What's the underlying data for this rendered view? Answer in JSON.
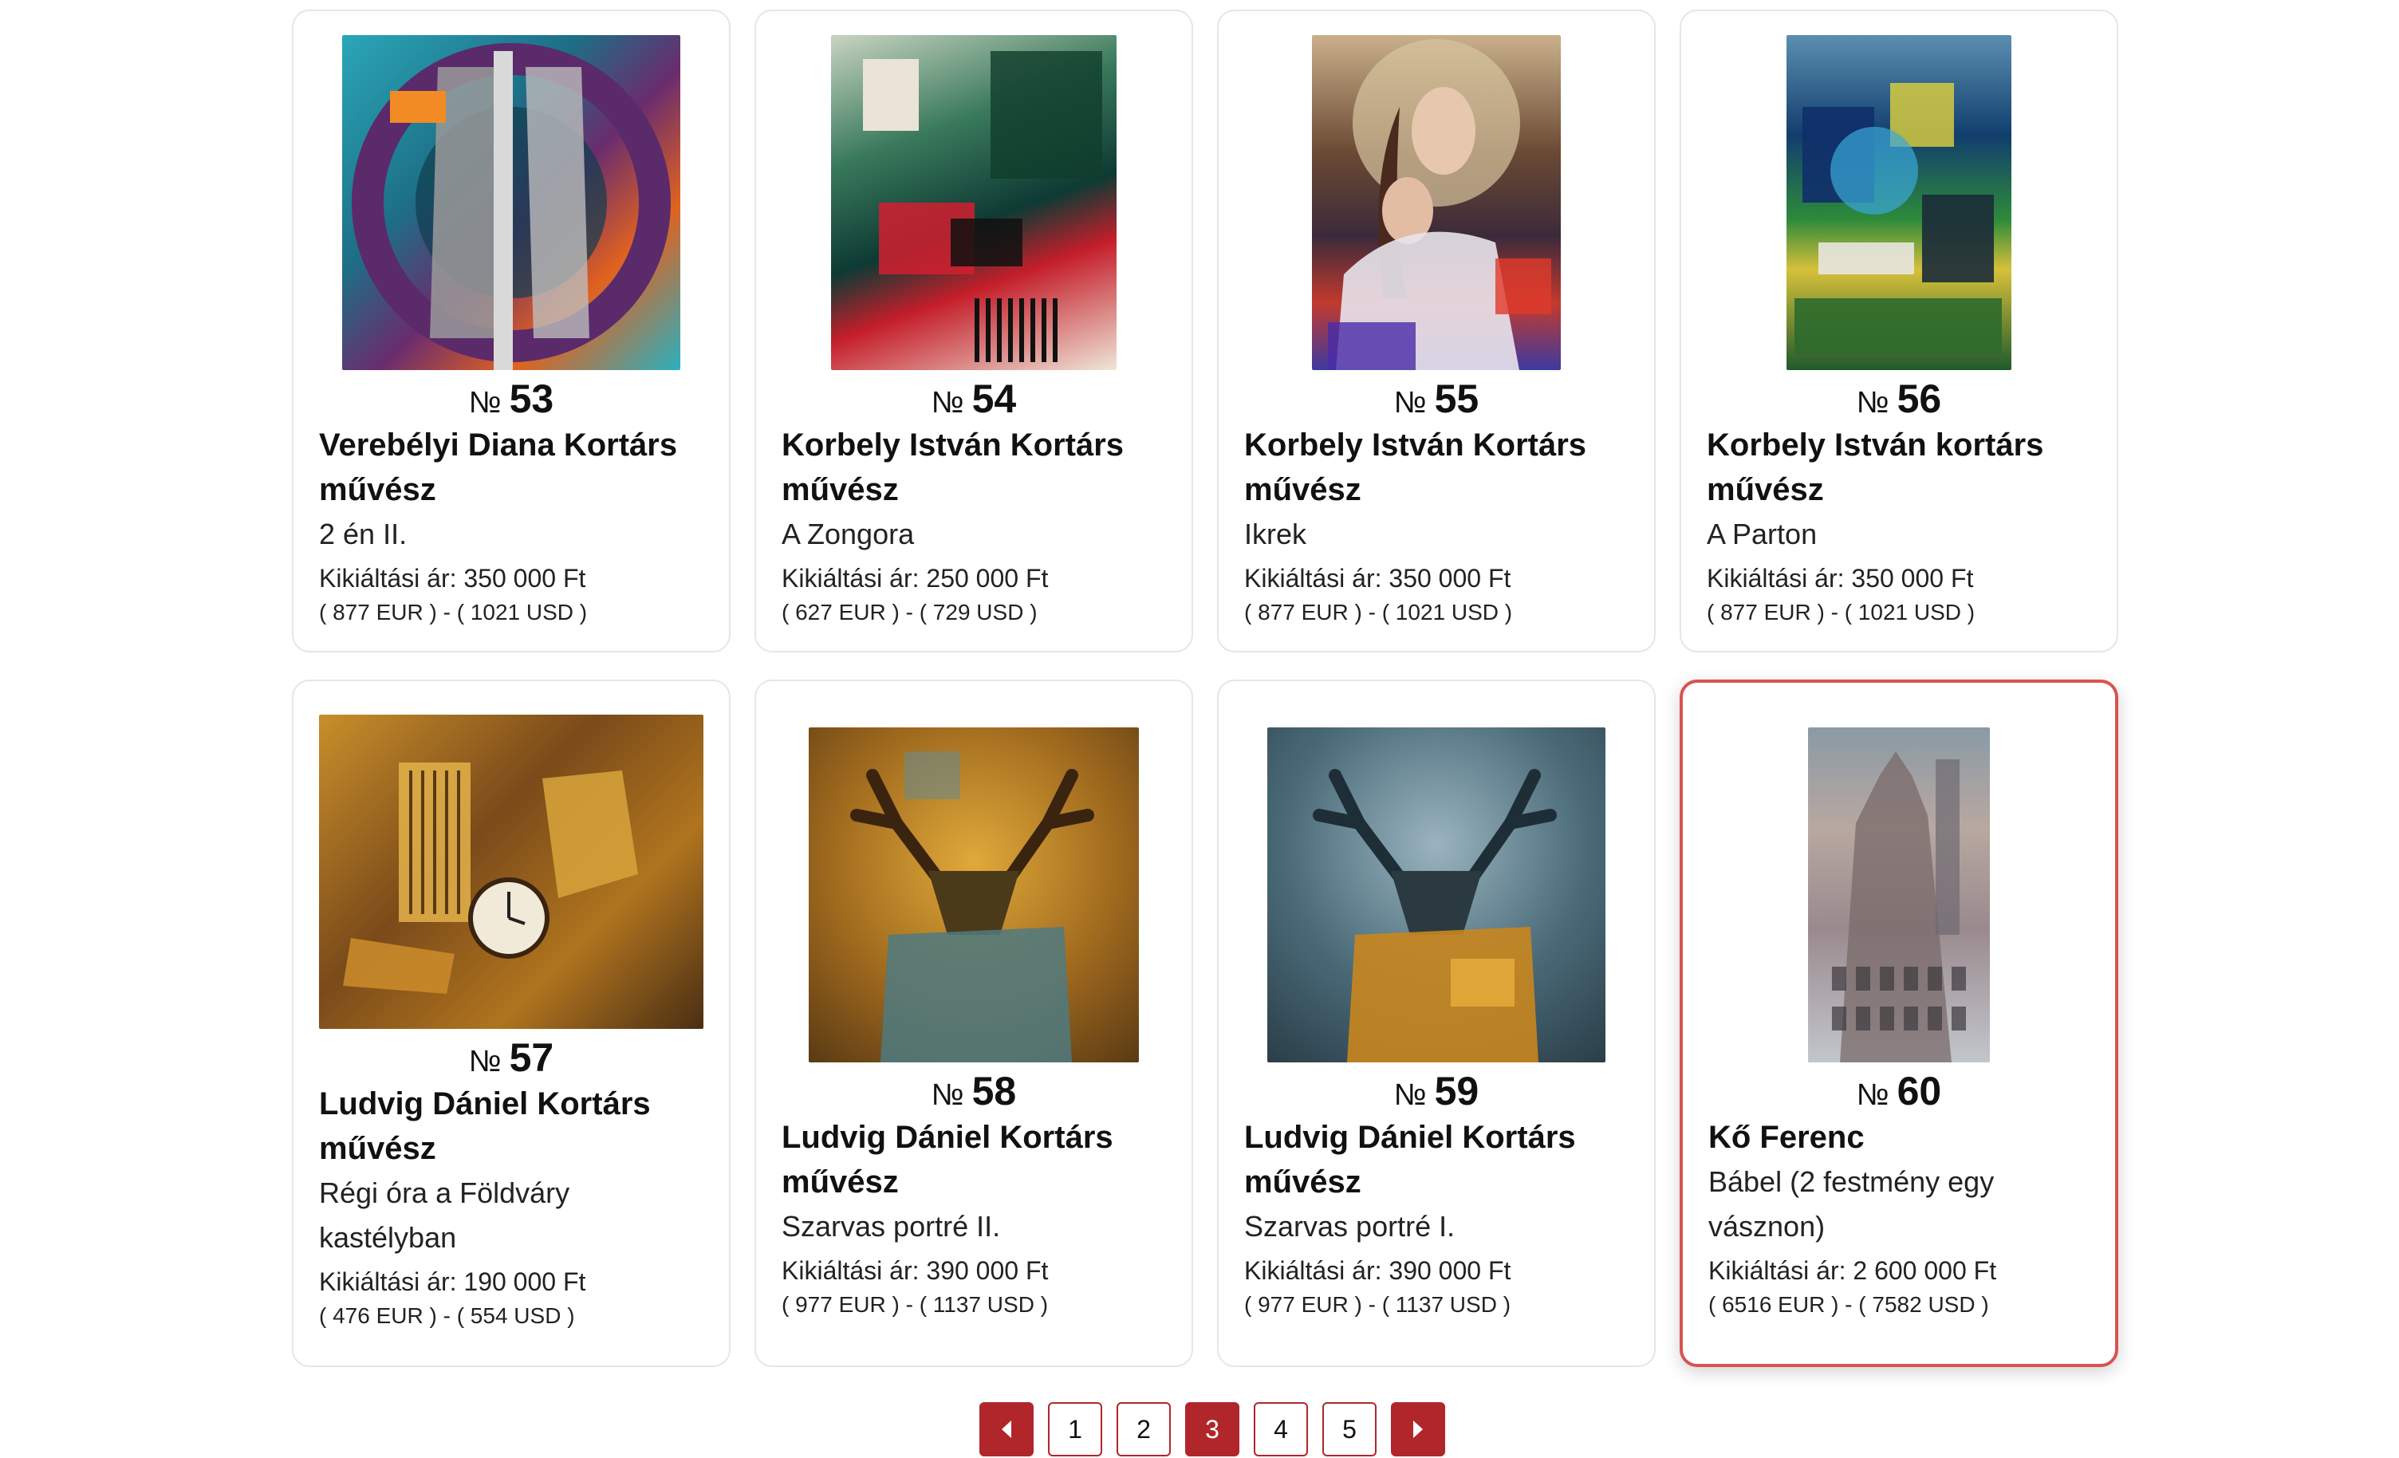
{
  "lots": [
    {
      "no_label": "№",
      "number": "53",
      "artist_line1": "Verebélyi Diana Kortárs",
      "artist_line2": "művész",
      "title_line1": "2 én II.",
      "title_line2": "",
      "price": "Kikiáltási ár: 350 000 Ft",
      "fx": "( 877 EUR ) - ( 1021 USD )",
      "image": "abstract-portrait-painting"
    },
    {
      "no_label": "№",
      "number": "54",
      "artist_line1": "Korbely István Kortárs",
      "artist_line2": "művész",
      "title_line1": "A Zongora",
      "title_line2": "",
      "price": "Kikiáltási ár: 250 000 Ft",
      "fx": "( 627 EUR ) - ( 729 USD )",
      "image": "abstract-piano-painting"
    },
    {
      "no_label": "№",
      "number": "55",
      "artist_line1": "Korbely István Kortárs",
      "artist_line2": "művész",
      "title_line1": "Ikrek",
      "title_line2": "",
      "price": "Kikiáltási ár: 350 000 Ft",
      "fx": "( 877 EUR ) - ( 1021 USD )",
      "image": "twins-figurative-painting"
    },
    {
      "no_label": "№",
      "number": "56",
      "artist_line1": "Korbely István kortárs",
      "artist_line2": "művész",
      "title_line1": "A Parton",
      "title_line2": "",
      "price": "Kikiáltási ár: 350 000 Ft",
      "fx": "( 877 EUR ) - ( 1021 USD )",
      "image": "abstract-shore-painting"
    },
    {
      "no_label": "№",
      "number": "57",
      "artist_line1": "Ludvig Dániel Kortárs",
      "artist_line2": "művész",
      "title_line1": "Régi óra a Földváry",
      "title_line2": "kastélyban",
      "price": "Kikiáltási ár: 190 000 Ft",
      "fx": "( 476 EUR ) - ( 554 USD )",
      "image": "old-clock-painting"
    },
    {
      "no_label": "№",
      "number": "58",
      "artist_line1": "Ludvig Dániel Kortárs",
      "artist_line2": "művész",
      "title_line1": "Szarvas portré II.",
      "title_line2": "",
      "price": "Kikiáltási ár: 390 000 Ft",
      "fx": "( 977 EUR ) - ( 1137 USD )",
      "image": "deer-portrait-golden"
    },
    {
      "no_label": "№",
      "number": "59",
      "artist_line1": "Ludvig Dániel Kortárs",
      "artist_line2": "művész",
      "title_line1": "Szarvas portré I.",
      "title_line2": "",
      "price": "Kikiáltási ár: 390 000 Ft",
      "fx": "( 977 EUR ) - ( 1137 USD )",
      "image": "deer-portrait-blue"
    },
    {
      "no_label": "№",
      "number": "60",
      "artist_line1": "Kő Ferenc",
      "artist_line2": "",
      "title_line1": "Bábel (2 festmény egy",
      "title_line2": "vásznon)",
      "price": "Kikiáltási ár: 2 600 000 Ft",
      "fx": "( 6516 EUR ) - ( 7582 USD )",
      "image": "babel-colosseum-painting"
    }
  ],
  "pagination": {
    "prev_icon": "caret-left-icon",
    "next_icon": "caret-right-icon",
    "pages": [
      "1",
      "2",
      "3",
      "4",
      "5"
    ],
    "current": "3"
  },
  "colors": {
    "accent": "#b0262b",
    "active_border": "#d9534f",
    "card_border": "#e6e6e6"
  }
}
